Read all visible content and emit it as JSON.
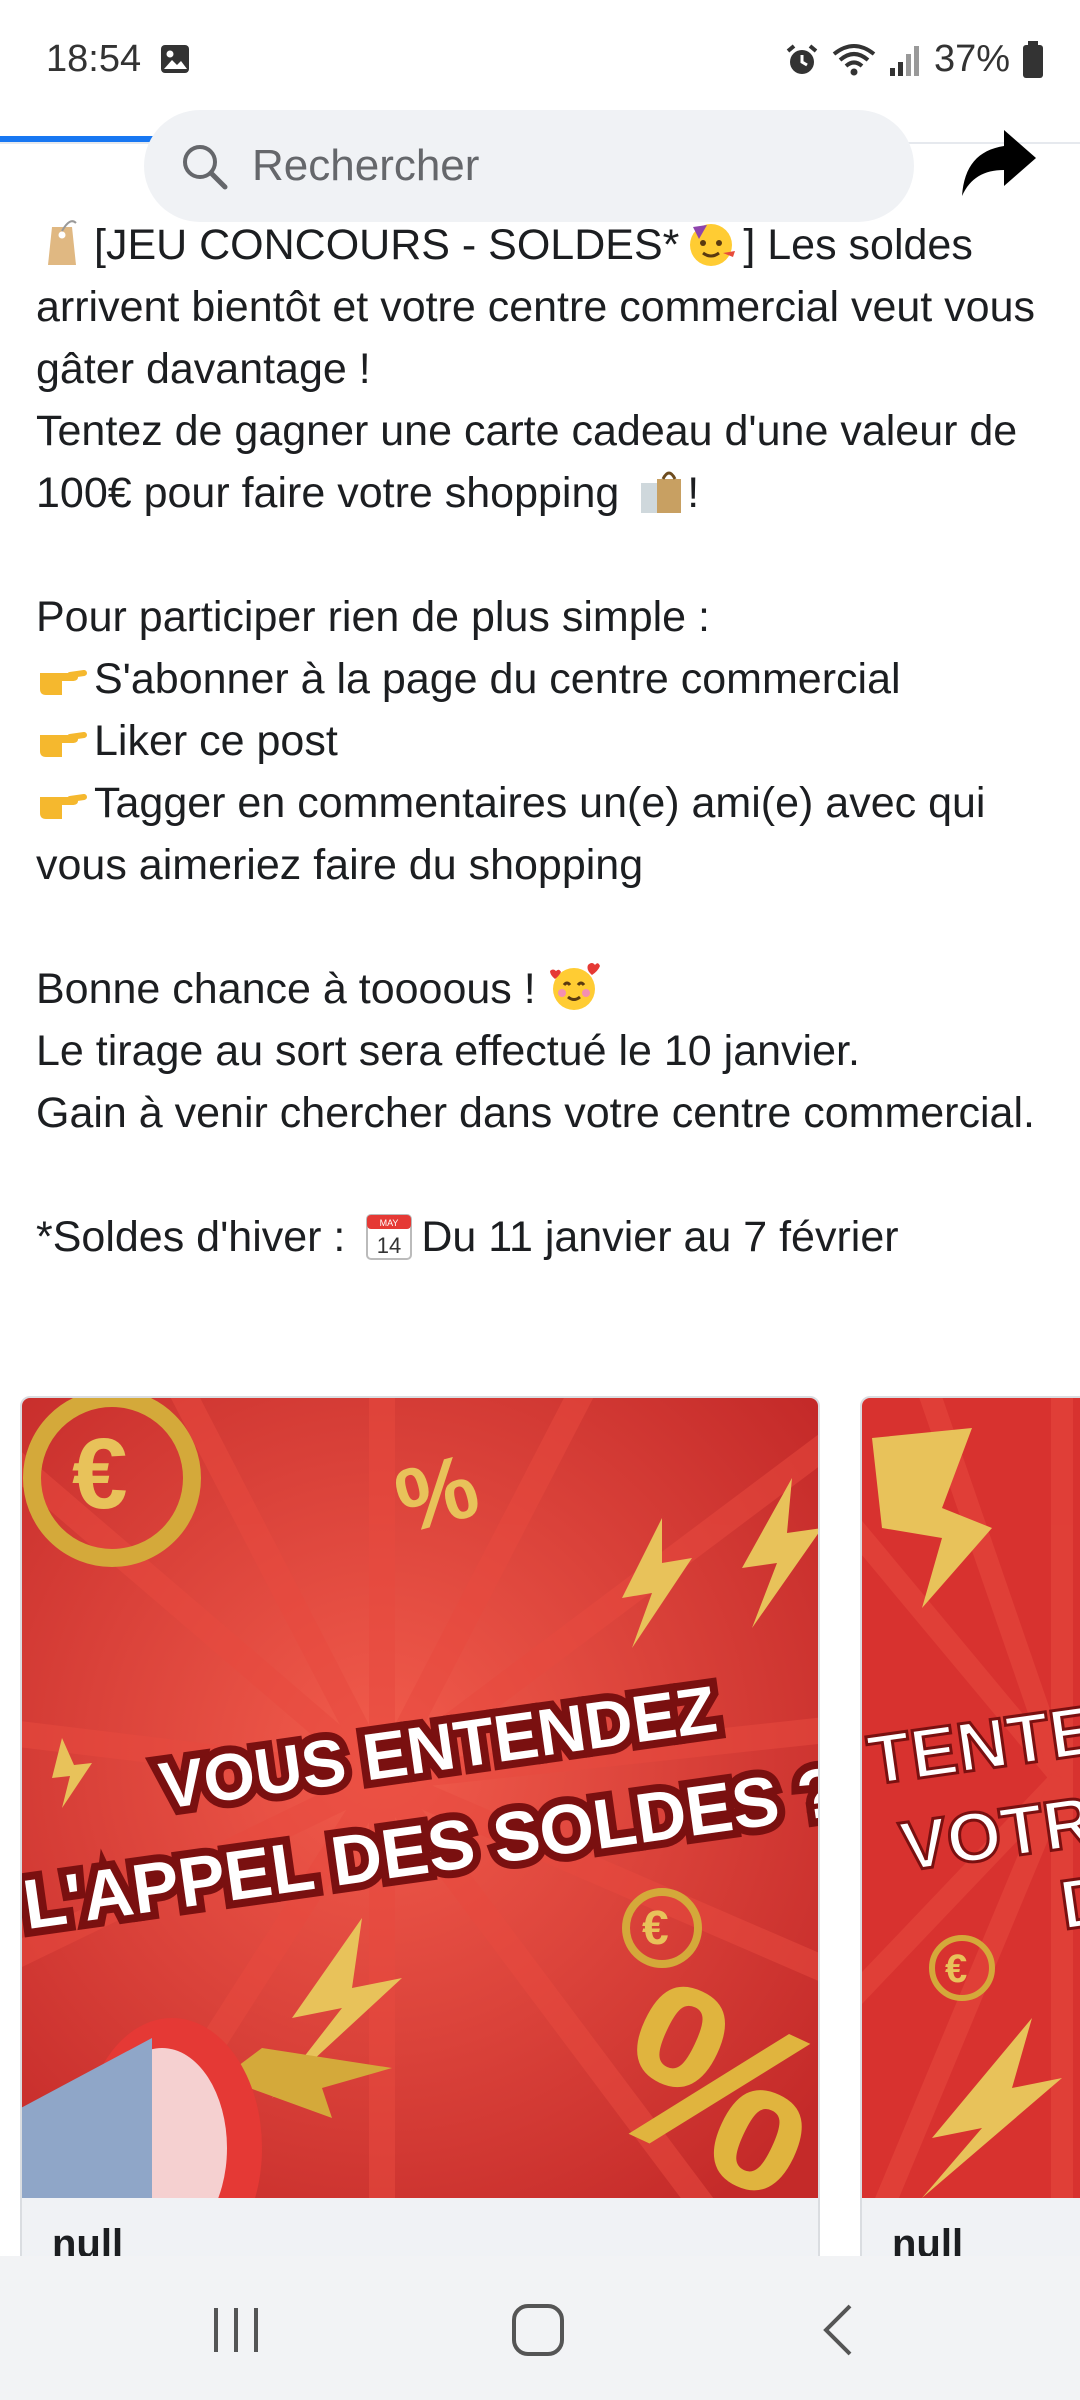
{
  "status_bar": {
    "time": "18:54",
    "battery": "37%",
    "icons": [
      "photo-icon",
      "alarm-icon",
      "wifi-icon",
      "signal-icon",
      "battery-icon"
    ]
  },
  "header": {
    "search_placeholder": "Rechercher",
    "icons": [
      "search-icon",
      "share-arrow-icon"
    ],
    "accent_color": "#1877f2"
  },
  "post": {
    "lines": [
      {
        "emoji": "tag",
        "text": "[JEU CONCOURS - SOLDES*"
      },
      {
        "text_after_emoji": "] Les soldes arrivent bientôt et votre centre commercial veut vous gâter davantage !"
      },
      {
        "text": "Tentez de gagner une carte cadeau d'une valeur de 100€ pour faire votre shopping"
      },
      {
        "text_after_emoji": "!"
      },
      {
        "text": "Pour participer rien de plus simple :"
      },
      {
        "text": "S'abonner à la page du centre commercial"
      },
      {
        "text": "Liker ce post"
      },
      {
        "text": "Tagger en commentaires un(e) ami(e) avec qui vous aimeriez faire du shopping"
      },
      {
        "text": "Bonne chance à toooous !"
      },
      {
        "text": "Le tirage au sort sera effectué le 10 janvier."
      },
      {
        "text": "Gain à venir chercher dans votre centre commercial."
      },
      {
        "text": "*Soldes d'hiver :"
      },
      {
        "text": "Du 11 janvier au 7 février"
      }
    ],
    "calendar_month": "MAY",
    "calendar_day": "14"
  },
  "carousel": {
    "cards": [
      {
        "headline_1": "VOUS ENTENDEZ",
        "headline_2": "L'APPEL DES SOLDES ?",
        "caption": "null",
        "bg_color": "#d8322f"
      },
      {
        "headline_1": "TENTE",
        "headline_2": "VOTR",
        "headline_3": "D",
        "caption": "null",
        "bg_color": "#d8322f"
      }
    ]
  },
  "nav_bar": {
    "buttons": [
      "recent-apps-icon",
      "home-icon",
      "back-icon"
    ]
  }
}
